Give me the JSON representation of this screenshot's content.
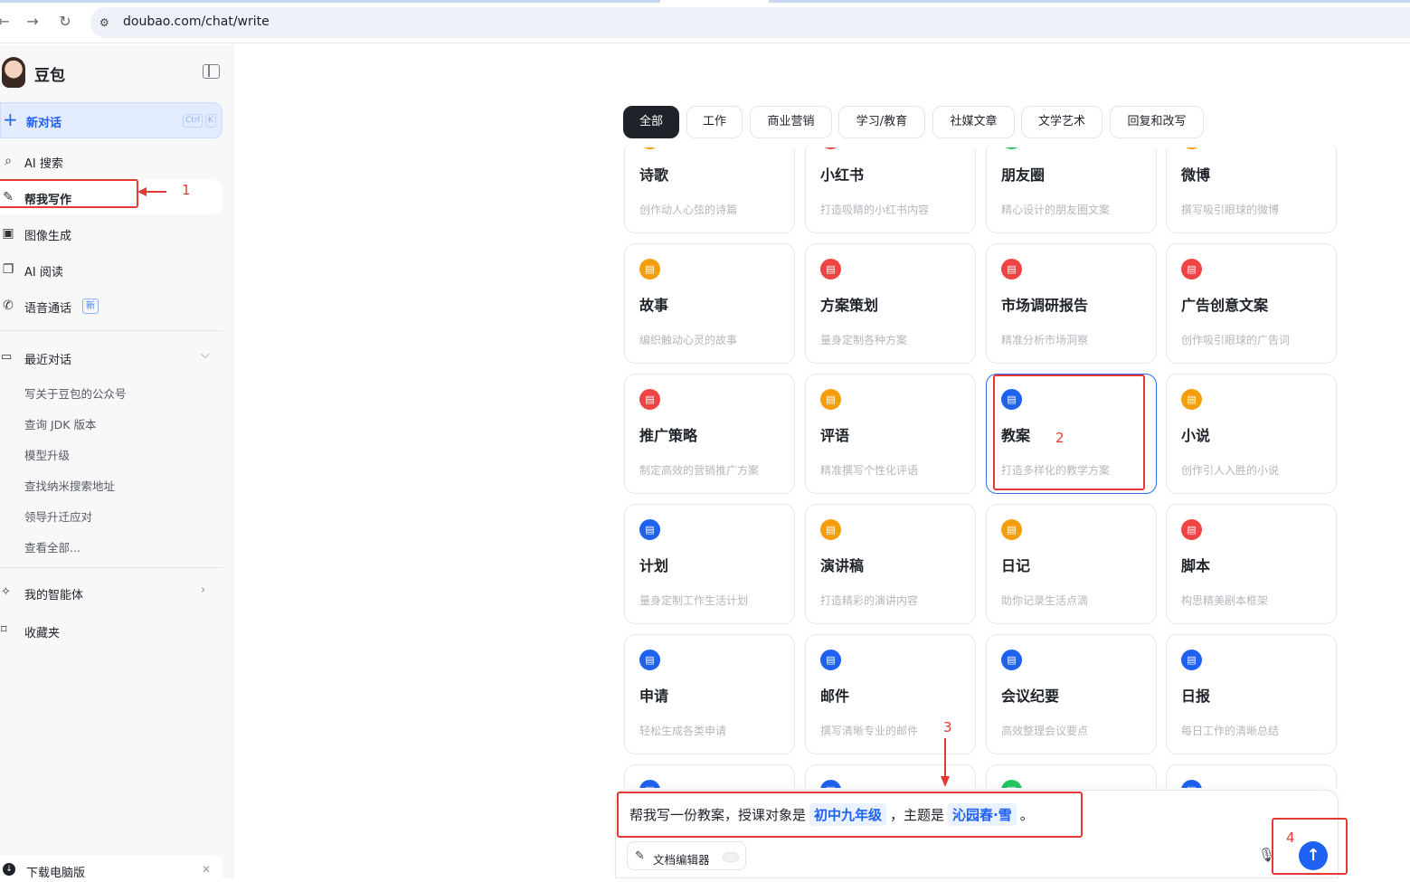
{
  "browser": {
    "url": "doubao.com/chat/write",
    "back_icon": "back-arrow-icon",
    "forward_icon": "forward-arrow-icon",
    "reload_icon": "reload-icon"
  },
  "sidebar": {
    "app_name": "豆包",
    "new_chat": {
      "label": "新对话",
      "shortcut_ctrl": "Ctrl",
      "shortcut_key": "K"
    },
    "nav": [
      {
        "label": "AI 搜索",
        "icon": "search-icon"
      },
      {
        "label": "帮我写作",
        "icon": "pen-icon"
      },
      {
        "label": "图像生成",
        "icon": "image-icon"
      },
      {
        "label": "AI 阅读",
        "icon": "book-icon"
      },
      {
        "label": "语音通话",
        "icon": "phone-icon",
        "badge": "新"
      }
    ],
    "recent": {
      "title": "最近对话",
      "items": [
        "写关于豆包的公众号",
        "查询 JDK 版本",
        "模型升级",
        "查找纳米搜索地址",
        "领导升迁应对"
      ],
      "view_all": "查看全部..."
    },
    "agents": "我的智能体",
    "favorites": "收藏夹",
    "download": "下载电脑版"
  },
  "categories": [
    "全部",
    "工作",
    "商业营销",
    "学习/教育",
    "社媒文章",
    "文学艺术",
    "回复和改写"
  ],
  "cards": [
    {
      "title": "诗歌",
      "desc": "创作动人心弦的诗篇",
      "color": "#f59e0b"
    },
    {
      "title": "小红书",
      "desc": "打造吸睛的小红书内容",
      "color": "#ef4444"
    },
    {
      "title": "朋友圈",
      "desc": "精心设计的朋友圈文案",
      "color": "#22c55e"
    },
    {
      "title": "微博",
      "desc": "撰写吸引眼球的微博",
      "color": "#f59e0b"
    },
    {
      "title": "故事",
      "desc": "编织触动心灵的故事",
      "color": "#f59e0b"
    },
    {
      "title": "方案策划",
      "desc": "量身定制各种方案",
      "color": "#ef4444"
    },
    {
      "title": "市场调研报告",
      "desc": "精准分析市场洞察",
      "color": "#ef4444"
    },
    {
      "title": "广告创意文案",
      "desc": "创作吸引眼球的广告词",
      "color": "#ef4444"
    },
    {
      "title": "推广策略",
      "desc": "制定高效的营销推广方案",
      "color": "#ef4444"
    },
    {
      "title": "评语",
      "desc": "精准撰写个性化评语",
      "color": "#f59e0b"
    },
    {
      "title": "教案",
      "desc": "打造多样化的教学方案",
      "color": "#1f61f0"
    },
    {
      "title": "小说",
      "desc": "创作引人入胜的小说",
      "color": "#f59e0b"
    },
    {
      "title": "计划",
      "desc": "量身定制工作生活计划",
      "color": "#1f61f0"
    },
    {
      "title": "演讲稿",
      "desc": "打造精彩的演讲内容",
      "color": "#f59e0b"
    },
    {
      "title": "日记",
      "desc": "助你记录生活点滴",
      "color": "#f59e0b"
    },
    {
      "title": "脚本",
      "desc": "构思精美剧本框架",
      "color": "#ef4444"
    },
    {
      "title": "申请",
      "desc": "轻松生成各类申请",
      "color": "#1f61f0"
    },
    {
      "title": "邮件",
      "desc": "撰写清晰专业的邮件",
      "color": "#1f61f0"
    },
    {
      "title": "会议纪要",
      "desc": "高效整理会议要点",
      "color": "#1f61f0"
    },
    {
      "title": "日报",
      "desc": "每日工作的清晰总结",
      "color": "#1f61f0"
    },
    {
      "title": "",
      "desc": "",
      "color": "#1f61f0"
    },
    {
      "title": "",
      "desc": "",
      "color": "#1f61f0"
    },
    {
      "title": "",
      "desc": "",
      "color": "#22c55e"
    },
    {
      "title": "",
      "desc": "",
      "color": "#1f61f0"
    }
  ],
  "composer": {
    "prompt_prefix": "帮我写一份教案，授课对象是",
    "slot_audience": "初中九年级",
    "prompt_mid": "，主题是",
    "slot_topic": "沁园春·雪",
    "prompt_end": "。",
    "doc_editor": "文档编辑器"
  },
  "annotations": {
    "n1": "1",
    "n2": "2",
    "n3": "3",
    "n4": "4",
    "color": "#e53935"
  }
}
